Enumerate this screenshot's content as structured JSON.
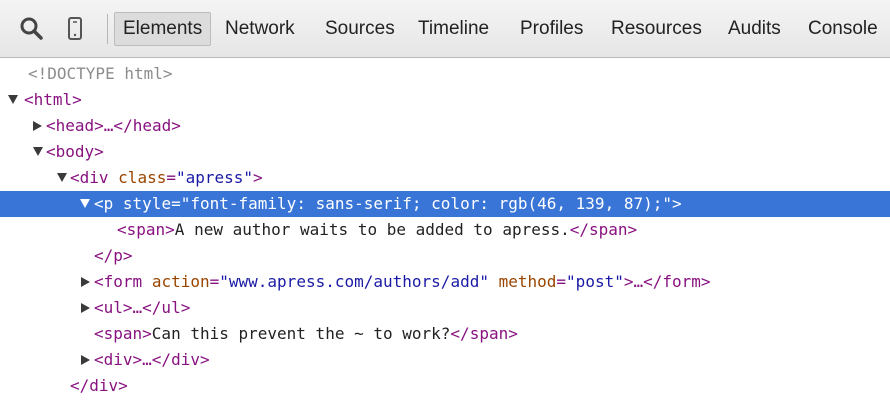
{
  "toolbar": {
    "icons": [
      "search-icon",
      "device-icon"
    ],
    "tabs": [
      {
        "label": "Elements",
        "active": true
      },
      {
        "label": "Network"
      },
      {
        "label": "Sources"
      },
      {
        "label": "Timeline"
      },
      {
        "label": "Profiles"
      },
      {
        "label": "Resources"
      },
      {
        "label": "Audits"
      },
      {
        "label": "Console"
      }
    ]
  },
  "colors": {
    "selection": "#3875d7",
    "tag": "#881280",
    "attribute_name": "#994500",
    "attribute_value": "#1a1aa6"
  },
  "dom": {
    "doctype": "<!DOCTYPE html>",
    "html_open": "<html>",
    "head": "<head>…</head>",
    "body_open": "<body>",
    "div_open": {
      "tag": "<div",
      "attr": "class",
      "eq": "=",
      "val": "\"apress\"",
      "close": ">"
    },
    "p_open": {
      "tag": "<p",
      "attr": "style",
      "eq": "=",
      "val": "\"font-family: sans-serif; color: rgb(46, 139, 87);\"",
      "close": ">"
    },
    "span1": {
      "open": "<span>",
      "text": "A new author waits to be added to apress.",
      "close": "</span>"
    },
    "p_close": "</p>",
    "form": {
      "tag": "<form",
      "attr1": "action",
      "eq1": "=",
      "val1": "\"www.apress.com/authors/add\"",
      "attr2": "method",
      "eq2": "=",
      "val2": "\"post\"",
      "close": ">…</form>"
    },
    "ul": "<ul>…</ul>",
    "span2": {
      "open": "<span>",
      "text": "Can this prevent the ~ to work?",
      "close": "</span>"
    },
    "div_collapsed": "<div>…</div>",
    "div_close": "</div>"
  }
}
